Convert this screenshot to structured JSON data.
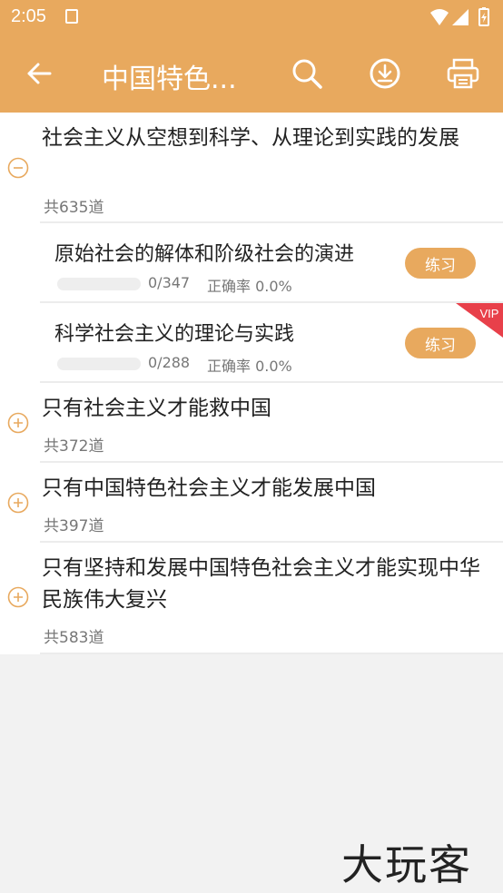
{
  "status_bar": {
    "time": "2:05"
  },
  "toolbar": {
    "title": "中国特色...",
    "icons": [
      "back-arrow-icon",
      "search-icon",
      "download-icon",
      "print-icon"
    ]
  },
  "chapters": [
    {
      "title": "社会主义从空想到科学、从理论到实践的发展",
      "count": "共635道",
      "expanded": true,
      "sections": [
        {
          "title": "原始社会的解体和阶级社会的演进",
          "progress": "0/347",
          "accuracy": "正确率 0.0%",
          "button": "练习"
        },
        {
          "title": "科学社会主义的理论与实践",
          "progress": "0/288",
          "accuracy": "正确率 0.0%",
          "button": "练习",
          "badge": "VIP"
        }
      ]
    },
    {
      "title": "只有社会主义才能救中国",
      "count": "共372道",
      "expanded": false
    },
    {
      "title": "只有中国特色社会主义才能发展中国",
      "count": "共397道",
      "expanded": false
    },
    {
      "title": "只有坚持和发展中国特色社会主义才能实现中华民族伟大复兴",
      "count": "共583道",
      "expanded": false
    }
  ],
  "watermark": "大玩客",
  "colors": {
    "accent": "#e8a95e",
    "vip": "#e8404a"
  }
}
